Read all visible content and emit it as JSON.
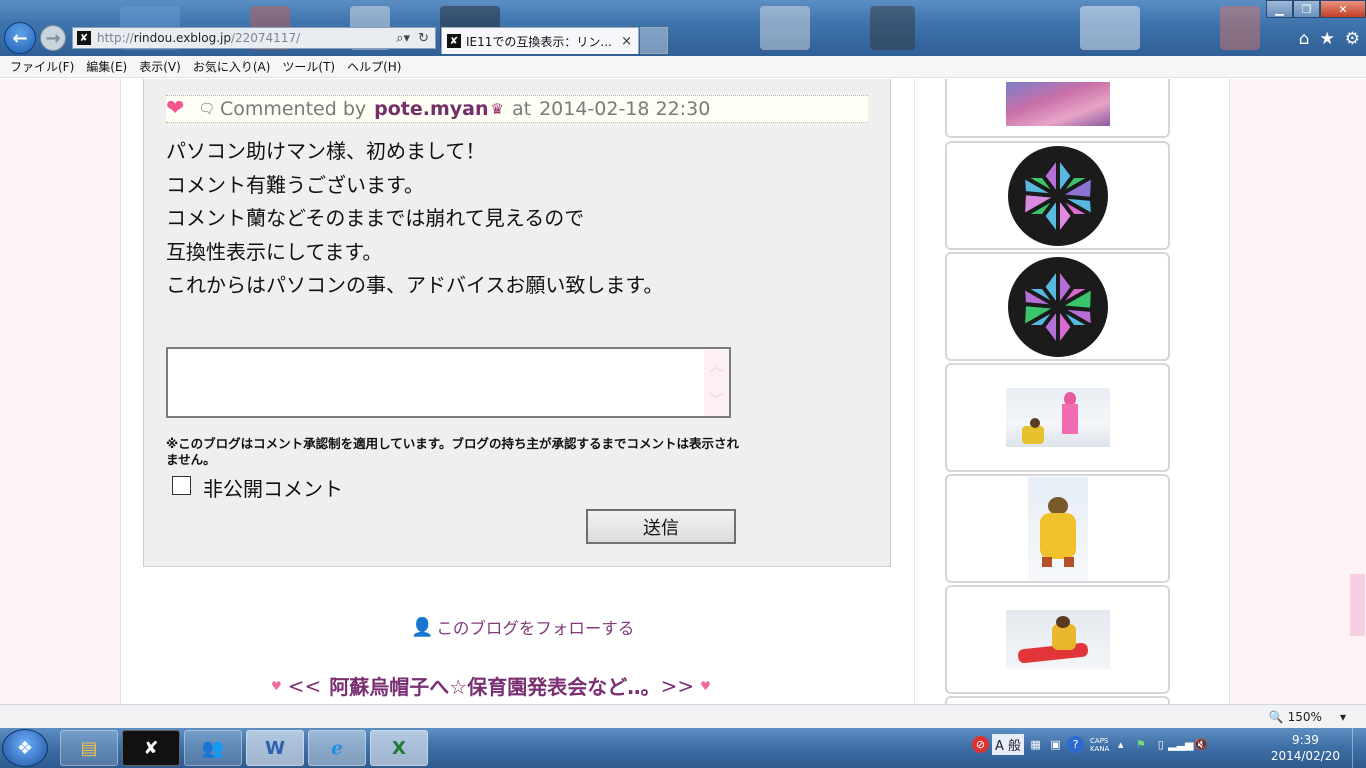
{
  "browser": {
    "url_prefix": "http://",
    "url_host": "rindou.exblog.jp",
    "url_path": "/22074117/",
    "tab_title": "IE11での互換表示：リン...",
    "tab_close": "×",
    "favicon": "✘",
    "icons": [
      "back-arrow-icon",
      "forward-arrow-icon",
      "search-icon",
      "refresh-icon",
      "home-icon",
      "star-icon",
      "gear-icon"
    ]
  },
  "menu": {
    "items": [
      "ファイル(F)",
      "編集(E)",
      "表示(V)",
      "お気に入り(A)",
      "ツール(T)",
      "ヘルプ(H)"
    ]
  },
  "comment": {
    "prefix": "Commented by",
    "author": "pote.myan",
    "at": "at",
    "timestamp": "2014-02-18 22:30",
    "lines": [
      "パソコン助けマン様、初めまして！",
      "コメント有難うございます。",
      "コメント蘭などそのままでは崩れて見えるので",
      "互換性表示にしてます。",
      "これからはパソコンの事、アドバイスお願い致します。"
    ]
  },
  "reply_form": {
    "textarea_value": "",
    "note": "※このブログはコメント承認制を適用しています。ブログの持ち主が承認するまでコメントは表示されません。",
    "private_label": "非公開コメント",
    "private_checked": false,
    "send_label": "送信"
  },
  "follow_link": "このブログをフォローする",
  "post_nav": {
    "prev": "<<",
    "title": "阿蘇烏帽子へ☆保育園発表会など‥。",
    "next": ">>"
  },
  "sidebar": {
    "thumbnails": [
      "plum-blossom-photo",
      "stained-glass-pattern",
      "stained-glass-pattern",
      "child-sledding-photo",
      "child-in-snow-photo",
      "child-on-sled-photo"
    ]
  },
  "statusbar": {
    "zoom": "150%"
  },
  "taskbar": {
    "tray_caps": "CAPS",
    "tray_kana": "KANA",
    "ime_label": "A 般",
    "time": "9:39",
    "date": "2014/02/20"
  },
  "colors": {
    "accent_purple": "#742f6b",
    "heart_pink": "#f0568f",
    "page_bg": "#fdf3f5"
  }
}
